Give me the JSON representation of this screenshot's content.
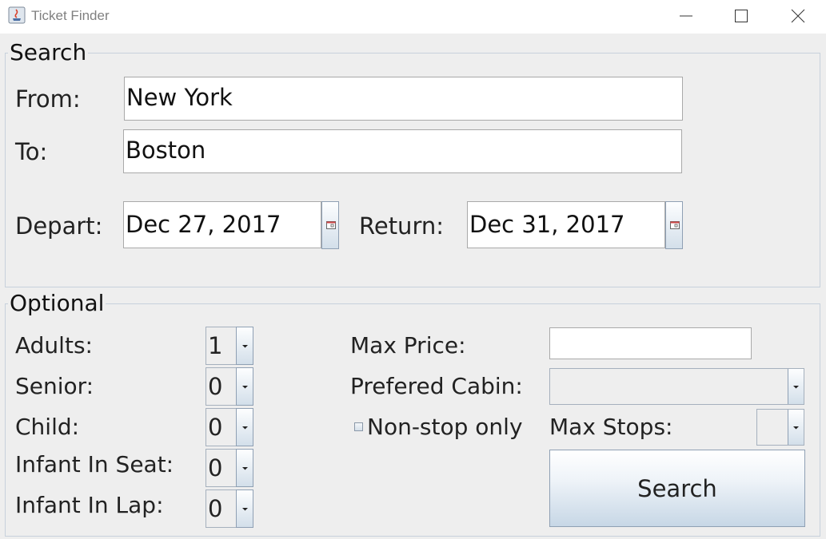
{
  "window": {
    "title": "Ticket Finder",
    "icons": [
      "java-app-icon",
      "minimize-icon",
      "maximize-icon",
      "close-icon"
    ]
  },
  "search_group": {
    "title": "Search",
    "from_label": "From:",
    "from_value": "New York",
    "to_label": "To:",
    "to_value": "Boston",
    "depart_label": "Depart:",
    "depart_value": "Dec 27, 2017",
    "return_label": "Return:",
    "return_value": "Dec 31, 2017"
  },
  "optional_group": {
    "title": "Optional",
    "adults_label": "Adults:",
    "adults_value": "1",
    "senior_label": "Senior:",
    "senior_value": "0",
    "child_label": "Child:",
    "child_value": "0",
    "infant_seat_label": "Infant In Seat:",
    "infant_seat_value": "0",
    "infant_lap_label": "Infant In Lap:",
    "infant_lap_value": "0",
    "max_price_label": "Max Price:",
    "max_price_value": "",
    "cabin_label": "Prefered Cabin:",
    "cabin_value": "",
    "nonstop_label": "Non-stop only",
    "nonstop_checked": false,
    "max_stops_label": "Max Stops:",
    "max_stops_value": "",
    "search_button": "Search"
  },
  "colors": {
    "background": "#eeeeee",
    "group_border": "#c7d1dc",
    "button_gradient_top": "#ffffff",
    "button_gradient_bottom": "#c7d7e6"
  }
}
